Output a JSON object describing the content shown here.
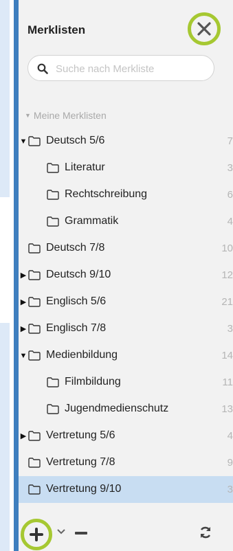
{
  "panel": {
    "title": "Merklisten",
    "search_placeholder": "Suche nach Merkliste",
    "section_label": "Meine Merklisten"
  },
  "tree": [
    {
      "label": "Deutsch 5/6",
      "count": "7",
      "level": 0,
      "caret": "expanded"
    },
    {
      "label": "Literatur",
      "count": "3",
      "level": 1,
      "caret": "none"
    },
    {
      "label": "Rechtschreibung",
      "count": "6",
      "level": 1,
      "caret": "none"
    },
    {
      "label": "Grammatik",
      "count": "4",
      "level": 1,
      "caret": "none"
    },
    {
      "label": "Deutsch 7/8",
      "count": "10",
      "level": 0,
      "caret": "none"
    },
    {
      "label": "Deutsch 9/10",
      "count": "12",
      "level": 0,
      "caret": "collapsed"
    },
    {
      "label": "Englisch 5/6",
      "count": "21",
      "level": 0,
      "caret": "collapsed"
    },
    {
      "label": "Englisch 7/8",
      "count": "3",
      "level": 0,
      "caret": "collapsed"
    },
    {
      "label": "Medienbildung",
      "count": "14",
      "level": 0,
      "caret": "expanded"
    },
    {
      "label": "Filmbildung",
      "count": "11",
      "level": 1,
      "caret": "none"
    },
    {
      "label": "Jugendmedienschutz",
      "count": "13",
      "level": 1,
      "caret": "none"
    },
    {
      "label": "Vertretung 5/6",
      "count": "4",
      "level": 0,
      "caret": "collapsed"
    },
    {
      "label": "Vertretung 7/8",
      "count": "9",
      "level": 0,
      "caret": "none"
    },
    {
      "label": "Vertretung 9/10",
      "count": "3",
      "level": 0,
      "caret": "none",
      "selected": true
    }
  ],
  "icons": {
    "close": "close-icon",
    "search": "search-icon",
    "add": "plus-icon",
    "dropdown": "chevron-down-icon",
    "remove": "minus-icon",
    "refresh": "refresh-icon",
    "folder": "folder-icon"
  },
  "colors": {
    "highlight_ring": "#a6c832",
    "selected_row": "#c8ddf2",
    "panel_border": "#3f7fbf",
    "panel_bg": "#f2f2f2"
  }
}
